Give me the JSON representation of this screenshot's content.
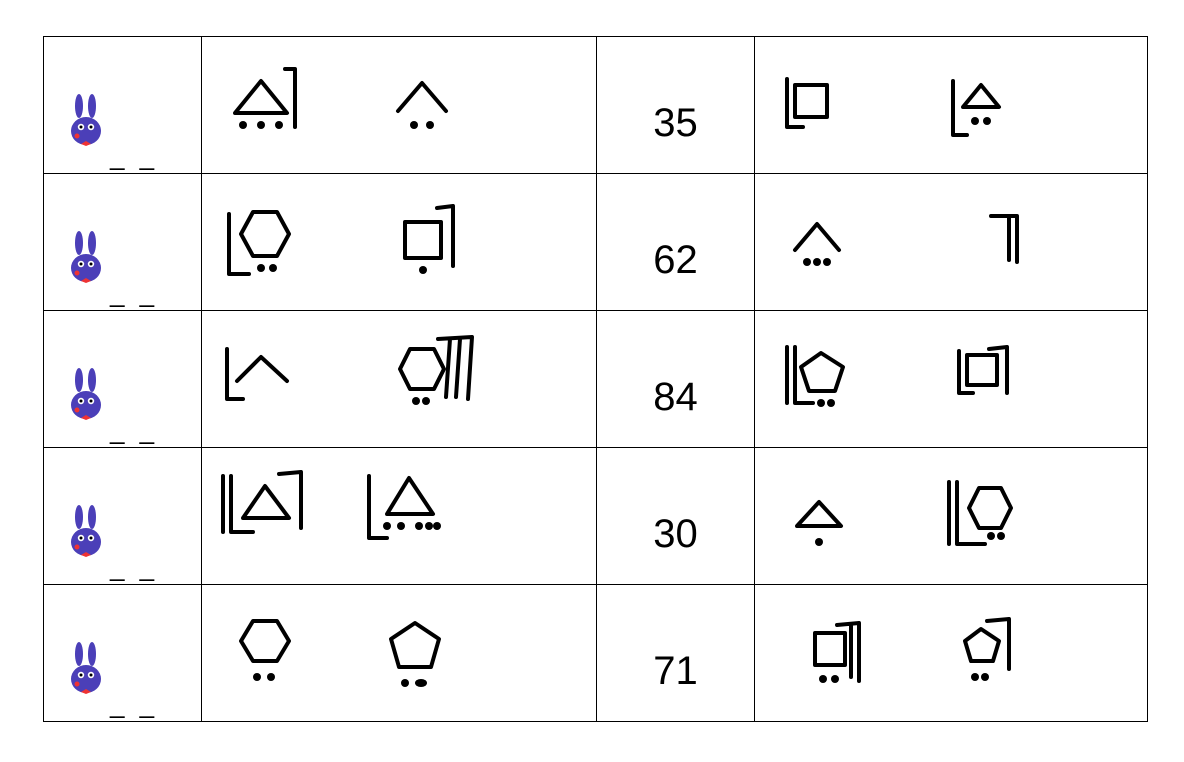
{
  "blank_marker": "_ _",
  "rows": [
    {
      "number": "35",
      "left_symbols": [
        "triangle-dots3-bracket-right",
        "chevron-dots2"
      ],
      "right_symbols": [
        "square-bracket-left",
        "triangle-dots2-bracket-left"
      ]
    },
    {
      "number": "62",
      "left_symbols": [
        "hexagon-dots2-bracket-left",
        "square-dot1-bracket-right"
      ],
      "right_symbols": [
        "chevron-dots3",
        "double-bracket-right"
      ]
    },
    {
      "number": "84",
      "left_symbols": [
        "chevron-bracket-left",
        "hexagon-dots2-triple-bracket-right"
      ],
      "right_symbols": [
        "pentagon-dots2-double-bracket-left",
        "square-bracket-left-right"
      ]
    },
    {
      "number": "30",
      "left_symbols": [
        "triangle-double-bracket-left-right",
        "triangle-dots5-bracket-left"
      ],
      "right_symbols": [
        "triangle-dot1",
        "hexagon-dots2-double-bracket-left"
      ]
    },
    {
      "number": "71",
      "left_symbols": [
        "hexagon-dots2",
        "pentagon-dots2"
      ],
      "right_symbols": [
        "square-dots2-double-bracket-right",
        "pentagon-dots2-bracket-right"
      ]
    }
  ]
}
